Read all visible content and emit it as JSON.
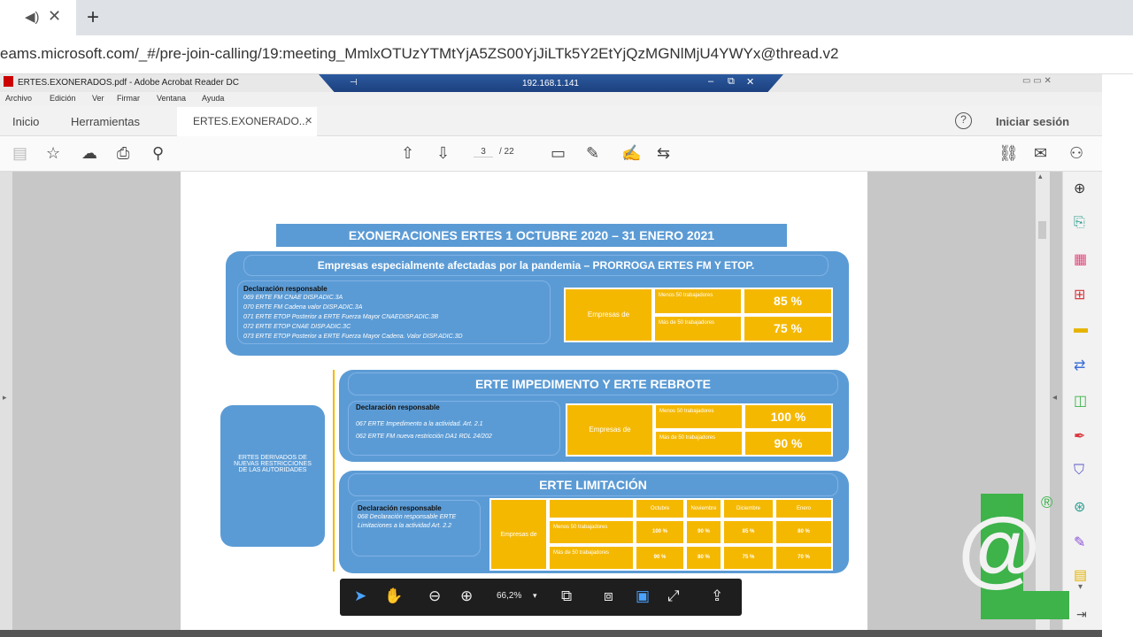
{
  "browser": {
    "url": "eams.microsoft.com/_#/pre-join-calling/19:meeting_MmlxOTUzYTMtYjA5ZS00YjJiLTk5Y2EtYjQzMGNlMjU4YWYx@thread.v2",
    "new_tab": "+"
  },
  "acrobat": {
    "title": "ERTES.EXONERADOS.pdf - Adobe Acrobat Reader DC",
    "rdp_host": "192.168.1.141",
    "menu": [
      "Archivo",
      "Edición",
      "Ver",
      "Firmar",
      "Ventana",
      "Ayuda"
    ],
    "tabs": {
      "home": "Inicio",
      "tools": "Herramientas",
      "file": "ERTES.EXONERADO...",
      "signin": "Iniciar sesión"
    },
    "page_current": "3",
    "page_total": "/ 22",
    "zoom": "66,2%"
  },
  "slide": {
    "title": "EXONERACIONES ERTES 1 OCTUBRE 2020 – 31 ENERO 2021",
    "s1": {
      "heading": "Empresas especialmente afectadas por la pandemia – PRORROGA ERTES FM Y ETOP.",
      "decl": "Declaración responsable",
      "lines": [
        "069 ERTE FM CNAE DISP.ADIC.3A",
        "070 ERTE FM Cadena valor DISP.ADIC.3A",
        "071 ERTE ETOP Posterior a ERTE Fuerza Mayor CNAEDISP.ADIC.3B",
        "072 ERTE ETOP CNAE DISP.ADIC.3C",
        "073 ERTE ETOP Posterior a ERTE Fuerza Mayor Cadena. Valor DISP.ADIC.3D"
      ],
      "empresas": "Empresas de",
      "row1": "Menos 50 trabajadores",
      "row2": "Más de 50 trabajadores",
      "pct1": "85 %",
      "pct2": "75 %"
    },
    "left_box": "ERTES DERIVADOS DE NUEVAS RESTRICCIONES DE LAS AUTORIDADES",
    "s2": {
      "heading": "ERTE IMPEDIMENTO Y ERTE REBROTE",
      "decl": "Declaración responsable",
      "lines": [
        "067 ERTE Impedimento a la actividad. Art. 2.1",
        "062 ERTE FM nueva restricción DA1 RDL 24/202"
      ],
      "empresas": "Empresas de",
      "row1": "Menos 50 trabajadores",
      "row2": "Más de 50 trabajadores",
      "pct1": "100 %",
      "pct2": "90 %"
    },
    "s3": {
      "heading": "ERTE LIMITACIÓN",
      "decl": "Declaración responsable",
      "lines": [
        "068 Declaración responsable ERTE Limitaciones a la actividad Art. 2.2"
      ],
      "empresas": "Empresas de",
      "months": [
        "Octubre",
        "Noviembre",
        "Diciembre",
        "Enero"
      ],
      "row1": "Menos 50 trabajadores",
      "row2": "Más de 50 trabajadores",
      "r1": [
        "100 %",
        "90 %",
        "85 %",
        "80 %"
      ],
      "r2": [
        "90 %",
        "80 %",
        "75 %",
        "70 %"
      ]
    }
  },
  "colors": {
    "blue": "#5b9bd5",
    "yellow": "#f5b800",
    "logo_green": "#3db34a"
  }
}
